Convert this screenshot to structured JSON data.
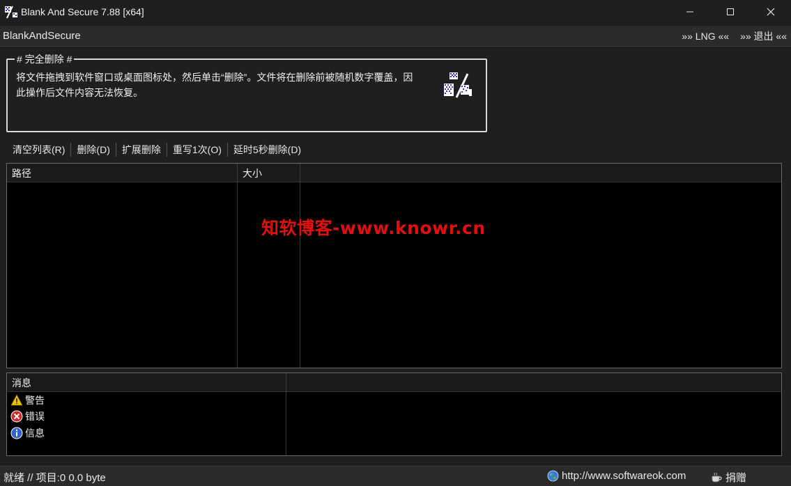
{
  "window": {
    "title": "Blank And Secure 7.88 [x64]",
    "minimize": "—",
    "maximize": "☐",
    "close": "✕"
  },
  "menu": {
    "app_label": "BlankAndSecure",
    "lng": "»» LNG ««",
    "exit": "»» 退出 ««"
  },
  "group": {
    "title": "# 完全删除 #",
    "description": "将文件拖拽到软件窗口或桌面图标处，然后单击“删除”。文件将在删除前被随机数字覆盖，因此操作后文件内容无法恢复。",
    "icon": "shredder-icon"
  },
  "toolbar": {
    "clear_list": "清空列表(R)",
    "delete": "删除(D)",
    "extended_delete": "扩展删除",
    "overwrite": "重写1次(O)",
    "delayed_delete": "延时5秒删除(D)"
  },
  "file_list": {
    "columns": [
      "路径",
      "大小",
      ""
    ],
    "rows": []
  },
  "watermark": "知软博客-www.knowr.cn",
  "messages": {
    "header": "消息",
    "items": [
      {
        "label": "警告",
        "icon": "warning-icon",
        "color": "#f2c200"
      },
      {
        "label": "错误",
        "icon": "error-icon",
        "color": "#d02a2a"
      },
      {
        "label": "信息",
        "icon": "info-icon",
        "color": "#2f63c9"
      }
    ]
  },
  "status": {
    "left": "就绪 // 项目:0 0.0 byte",
    "url": "http://www.softwareok.com",
    "donate": "捐赠"
  },
  "colors": {
    "background": "#1f1f1f",
    "list_background": "#000000",
    "watermark": "#e01010"
  }
}
